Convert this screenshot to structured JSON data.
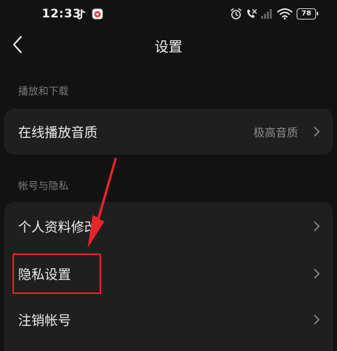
{
  "status_bar": {
    "time": "12:33",
    "battery_level": "78",
    "icons": [
      "tiktok-icon",
      "app-notification-icon",
      "alarm-icon",
      "no-sound-icon",
      "cellular-signal-icon",
      "wifi-icon",
      "battery-icon"
    ]
  },
  "header": {
    "title": "设置",
    "back_icon": "chevron-left-icon"
  },
  "sections": [
    {
      "label": "播放和下载",
      "items": [
        {
          "label": "在线播放音质",
          "value": "极高音质"
        }
      ]
    },
    {
      "label": "帐号与隐私",
      "items": [
        {
          "label": "个人资料修改"
        },
        {
          "label": "隐私设置"
        },
        {
          "label": "注销帐号"
        }
      ]
    }
  ],
  "annotation": {
    "color": "#e8242c",
    "highlighted_item": "隐私设置"
  },
  "colors": {
    "background": "#121212",
    "card": "#1f1f1f",
    "text_primary": "#ececec",
    "text_secondary": "#8c8c8c",
    "section_label": "#7a7a7a"
  }
}
